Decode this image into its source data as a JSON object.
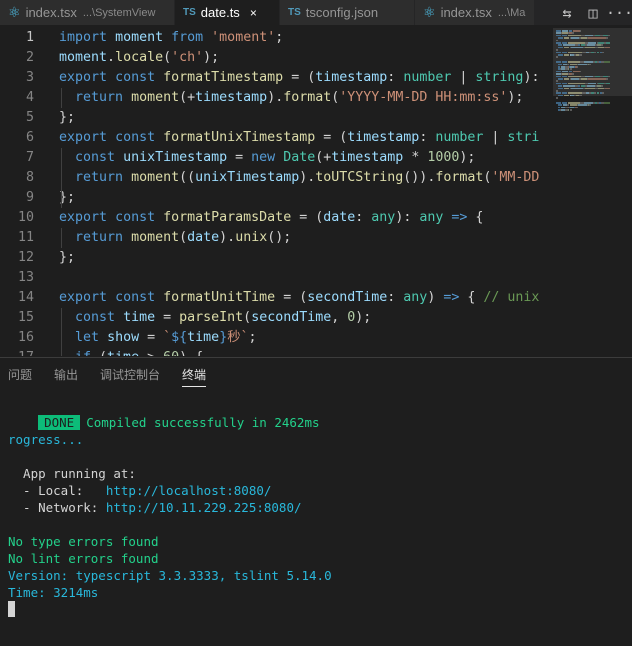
{
  "tabs": [
    {
      "name": "index.tsx",
      "desc": "...\\SystemView",
      "icon": "react-icon",
      "active": false
    },
    {
      "name": "date.ts",
      "desc": "",
      "icon": "ts-file-icon",
      "active": true,
      "close": "×"
    },
    {
      "name": "tsconfig.json",
      "desc": "",
      "icon": "tsconfig-file-icon",
      "active": false
    },
    {
      "name": "index.tsx",
      "desc": "...\\Ma",
      "icon": "react-icon",
      "active": false
    }
  ],
  "tab_icon_glyphs": {
    "react": "⚛",
    "ts": "TS",
    "tsconfig": "TS"
  },
  "tab_actions": {
    "compare": "⇆",
    "split": "◫",
    "more": "···"
  },
  "code": {
    "line_numbers": [
      "1",
      "2",
      "3",
      "4",
      "5",
      "6",
      "7",
      "8",
      "9",
      "10",
      "11",
      "12",
      "13",
      "14",
      "15",
      "16",
      "17"
    ],
    "lines": [
      [
        [
          "kw",
          "import"
        ],
        [
          "pun",
          " "
        ],
        [
          "var",
          "moment"
        ],
        [
          "pun",
          " "
        ],
        [
          "kw",
          "from"
        ],
        [
          "pun",
          " "
        ],
        [
          "str",
          "'moment'"
        ],
        [
          "pun",
          ";"
        ]
      ],
      [
        [
          "var",
          "moment"
        ],
        [
          "pun",
          "."
        ],
        [
          "fn",
          "locale"
        ],
        [
          "pun",
          "("
        ],
        [
          "str",
          "'ch'"
        ],
        [
          "pun",
          ");"
        ]
      ],
      [
        [
          "kw",
          "export"
        ],
        [
          "pun",
          " "
        ],
        [
          "kw",
          "const"
        ],
        [
          "pun",
          " "
        ],
        [
          "fn",
          "formatTimestamp"
        ],
        [
          "pun",
          " = ("
        ],
        [
          "var",
          "timestamp"
        ],
        [
          "pun",
          ": "
        ],
        [
          "type",
          "number"
        ],
        [
          "pun",
          " | "
        ],
        [
          "type",
          "string"
        ],
        [
          "pun",
          "):"
        ]
      ],
      [
        [
          "pun",
          "  "
        ],
        [
          "kw",
          "return"
        ],
        [
          "pun",
          " "
        ],
        [
          "fn",
          "moment"
        ],
        [
          "pun",
          "(+"
        ],
        [
          "var",
          "timestamp"
        ],
        [
          "pun",
          ")."
        ],
        [
          "fn",
          "format"
        ],
        [
          "pun",
          "("
        ],
        [
          "str",
          "'YYYY-MM-DD HH:mm:ss'"
        ],
        [
          "pun",
          ");"
        ]
      ],
      [
        [
          "pun",
          "};"
        ]
      ],
      [
        [
          "kw",
          "export"
        ],
        [
          "pun",
          " "
        ],
        [
          "kw",
          "const"
        ],
        [
          "pun",
          " "
        ],
        [
          "fn",
          "formatUnixTimestamp"
        ],
        [
          "pun",
          " = ("
        ],
        [
          "var",
          "timestamp"
        ],
        [
          "pun",
          ": "
        ],
        [
          "type",
          "number"
        ],
        [
          "pun",
          " | "
        ],
        [
          "type",
          "stri"
        ]
      ],
      [
        [
          "pun",
          "  "
        ],
        [
          "kw",
          "const"
        ],
        [
          "pun",
          " "
        ],
        [
          "var",
          "unixTimestamp"
        ],
        [
          "pun",
          " = "
        ],
        [
          "kw",
          "new"
        ],
        [
          "pun",
          " "
        ],
        [
          "type",
          "Date"
        ],
        [
          "pun",
          "(+"
        ],
        [
          "var",
          "timestamp"
        ],
        [
          "pun",
          " * "
        ],
        [
          "num",
          "1000"
        ],
        [
          "pun",
          ");"
        ]
      ],
      [
        [
          "pun",
          "  "
        ],
        [
          "kw",
          "return"
        ],
        [
          "pun",
          " "
        ],
        [
          "fn",
          "moment"
        ],
        [
          "pun",
          "(("
        ],
        [
          "var",
          "unixTimestamp"
        ],
        [
          "pun",
          ")."
        ],
        [
          "fn",
          "toUTCString"
        ],
        [
          "pun",
          "())."
        ],
        [
          "fn",
          "format"
        ],
        [
          "pun",
          "("
        ],
        [
          "str",
          "'MM-DD"
        ]
      ],
      [
        [
          "pun",
          "};"
        ]
      ],
      [
        [
          "kw",
          "export"
        ],
        [
          "pun",
          " "
        ],
        [
          "kw",
          "const"
        ],
        [
          "pun",
          " "
        ],
        [
          "fn",
          "formatParamsDate"
        ],
        [
          "pun",
          " = ("
        ],
        [
          "var",
          "date"
        ],
        [
          "pun",
          ": "
        ],
        [
          "type",
          "any"
        ],
        [
          "pun",
          "): "
        ],
        [
          "type",
          "any"
        ],
        [
          "pun",
          " "
        ],
        [
          "kw",
          "=>"
        ],
        [
          "pun",
          " {"
        ]
      ],
      [
        [
          "pun",
          "  "
        ],
        [
          "kw",
          "return"
        ],
        [
          "pun",
          " "
        ],
        [
          "fn",
          "moment"
        ],
        [
          "pun",
          "("
        ],
        [
          "var",
          "date"
        ],
        [
          "pun",
          ")."
        ],
        [
          "fn",
          "unix"
        ],
        [
          "pun",
          "();"
        ]
      ],
      [
        [
          "pun",
          "};"
        ]
      ],
      [],
      [
        [
          "kw",
          "export"
        ],
        [
          "pun",
          " "
        ],
        [
          "kw",
          "const"
        ],
        [
          "pun",
          " "
        ],
        [
          "fn",
          "formatUnitTime"
        ],
        [
          "pun",
          " = ("
        ],
        [
          "var",
          "secondTime"
        ],
        [
          "pun",
          ": "
        ],
        [
          "type",
          "any"
        ],
        [
          "pun",
          ") "
        ],
        [
          "kw",
          "=>"
        ],
        [
          "pun",
          " { "
        ],
        [
          "cmt",
          "// unix"
        ]
      ],
      [
        [
          "pun",
          "  "
        ],
        [
          "kw",
          "const"
        ],
        [
          "pun",
          " "
        ],
        [
          "var",
          "time"
        ],
        [
          "pun",
          " = "
        ],
        [
          "fn",
          "parseInt"
        ],
        [
          "pun",
          "("
        ],
        [
          "var",
          "secondTime"
        ],
        [
          "pun",
          ", "
        ],
        [
          "num",
          "0"
        ],
        [
          "pun",
          ");"
        ]
      ],
      [
        [
          "pun",
          "  "
        ],
        [
          "kw",
          "let"
        ],
        [
          "pun",
          " "
        ],
        [
          "var",
          "show"
        ],
        [
          "pun",
          " = "
        ],
        [
          "str",
          "`"
        ],
        [
          "kw",
          "${"
        ],
        [
          "var",
          "time"
        ],
        [
          "kw",
          "}"
        ],
        [
          "str",
          "秒`"
        ],
        [
          "pun",
          ";"
        ]
      ],
      [
        [
          "pun",
          "  "
        ],
        [
          "kw",
          "if"
        ],
        [
          "pun",
          " ("
        ],
        [
          "var",
          "time"
        ],
        [
          "pun",
          " > "
        ],
        [
          "num",
          "60"
        ],
        [
          "pun",
          ") {"
        ]
      ]
    ]
  },
  "panel": {
    "tabs": [
      {
        "label": "问题",
        "active": false
      },
      {
        "label": "输出",
        "active": false
      },
      {
        "label": "调试控制台",
        "active": false
      },
      {
        "label": "终端",
        "active": true
      }
    ]
  },
  "terminal": {
    "done_badge": "DONE",
    "compiled": "Compiled successfully in 2462ms",
    "progress": "rogress...",
    "app_running": "  App running at:",
    "local_label": "  - Local:   ",
    "local_url": "http://localhost:8080/",
    "network_label": "  - Network: ",
    "network_url": "http://10.11.229.225:8080/",
    "no_type_errors": "No type errors found",
    "no_lint_errors": "No lint errors found",
    "version": "Version: typescript 3.3.3333, tslint 5.14.0",
    "time": "Time: 3214ms"
  }
}
